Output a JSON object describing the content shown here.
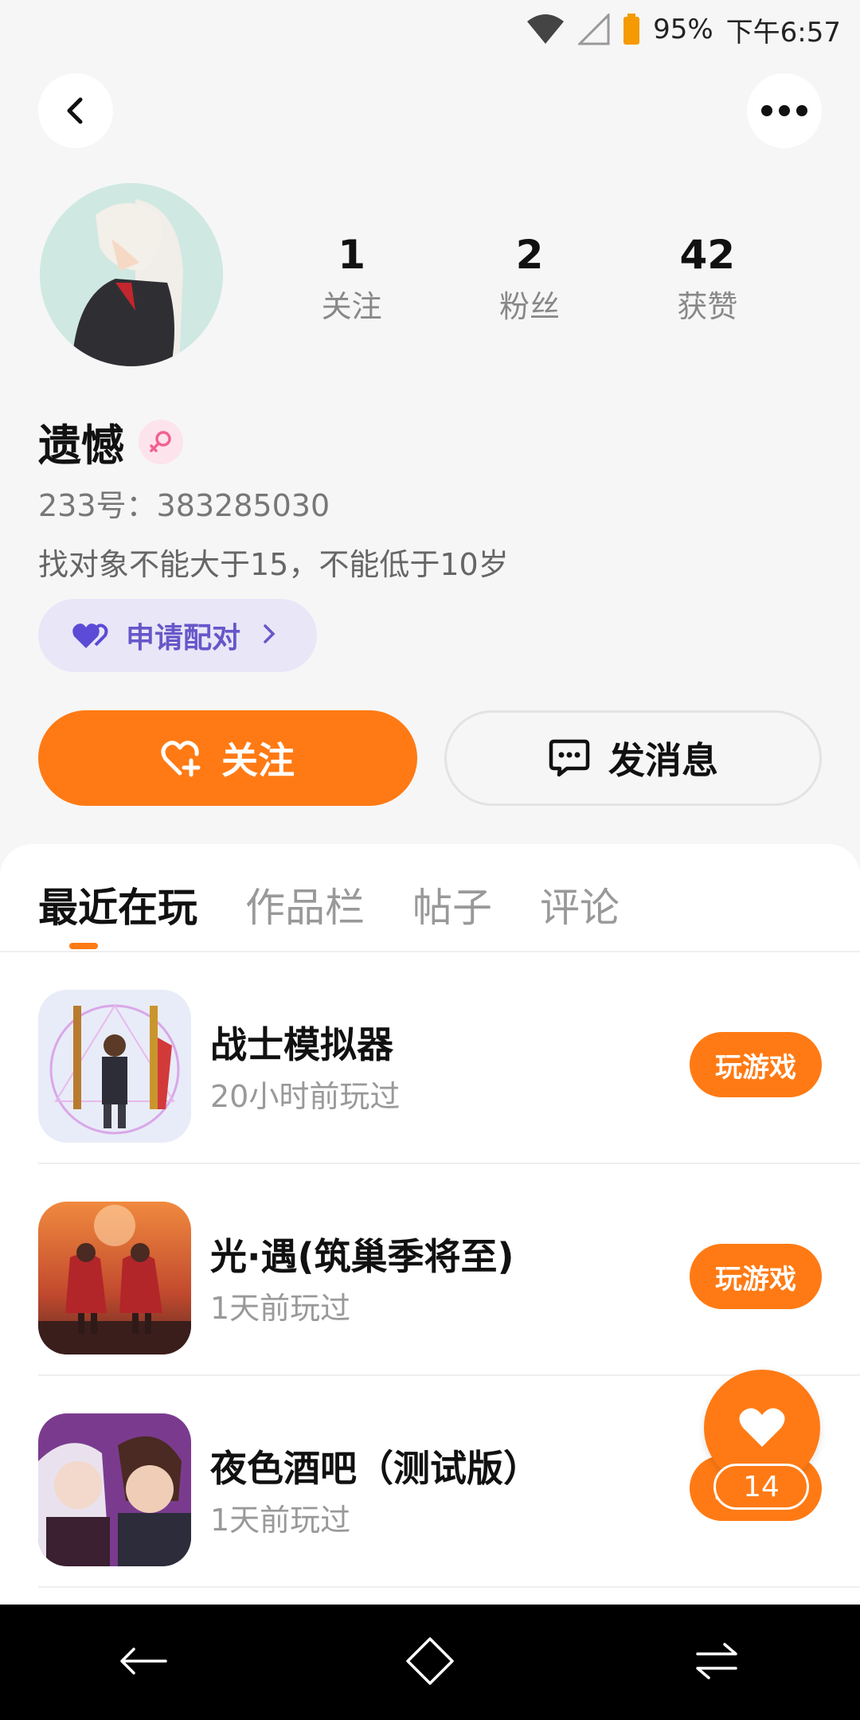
{
  "status_bar": {
    "battery": "95%",
    "time": "下午6:57"
  },
  "profile": {
    "stats": [
      {
        "number": "1",
        "label": "关注"
      },
      {
        "number": "2",
        "label": "粉丝"
      },
      {
        "number": "42",
        "label": "获赞"
      }
    ],
    "nickname": "遗憾",
    "user_id": "233号：383285030",
    "bio": "找对象不能大于15，不能低于10岁",
    "pair_label": "申请配对"
  },
  "actions": {
    "follow_label": "关注",
    "message_label": "发消息"
  },
  "tabs": [
    {
      "label": "最近在玩",
      "active": true
    },
    {
      "label": "作品栏",
      "active": false
    },
    {
      "label": "帖子",
      "active": false
    },
    {
      "label": "评论",
      "active": false
    }
  ],
  "games": [
    {
      "title": "战士模拟器",
      "time": "20小时前玩过",
      "button": "玩游戏"
    },
    {
      "title": "光·遇(筑巢季将至)",
      "time": "1天前玩过",
      "button": "玩游戏"
    },
    {
      "title": "夜色酒吧（测试版）",
      "time": "1天前玩过",
      "button": "玩游戏"
    }
  ],
  "like_fab": {
    "count": "14"
  },
  "colors": {
    "accent": "#ff7a14",
    "pair_bg": "#e9e6f8",
    "pair_text": "#6657c9"
  }
}
